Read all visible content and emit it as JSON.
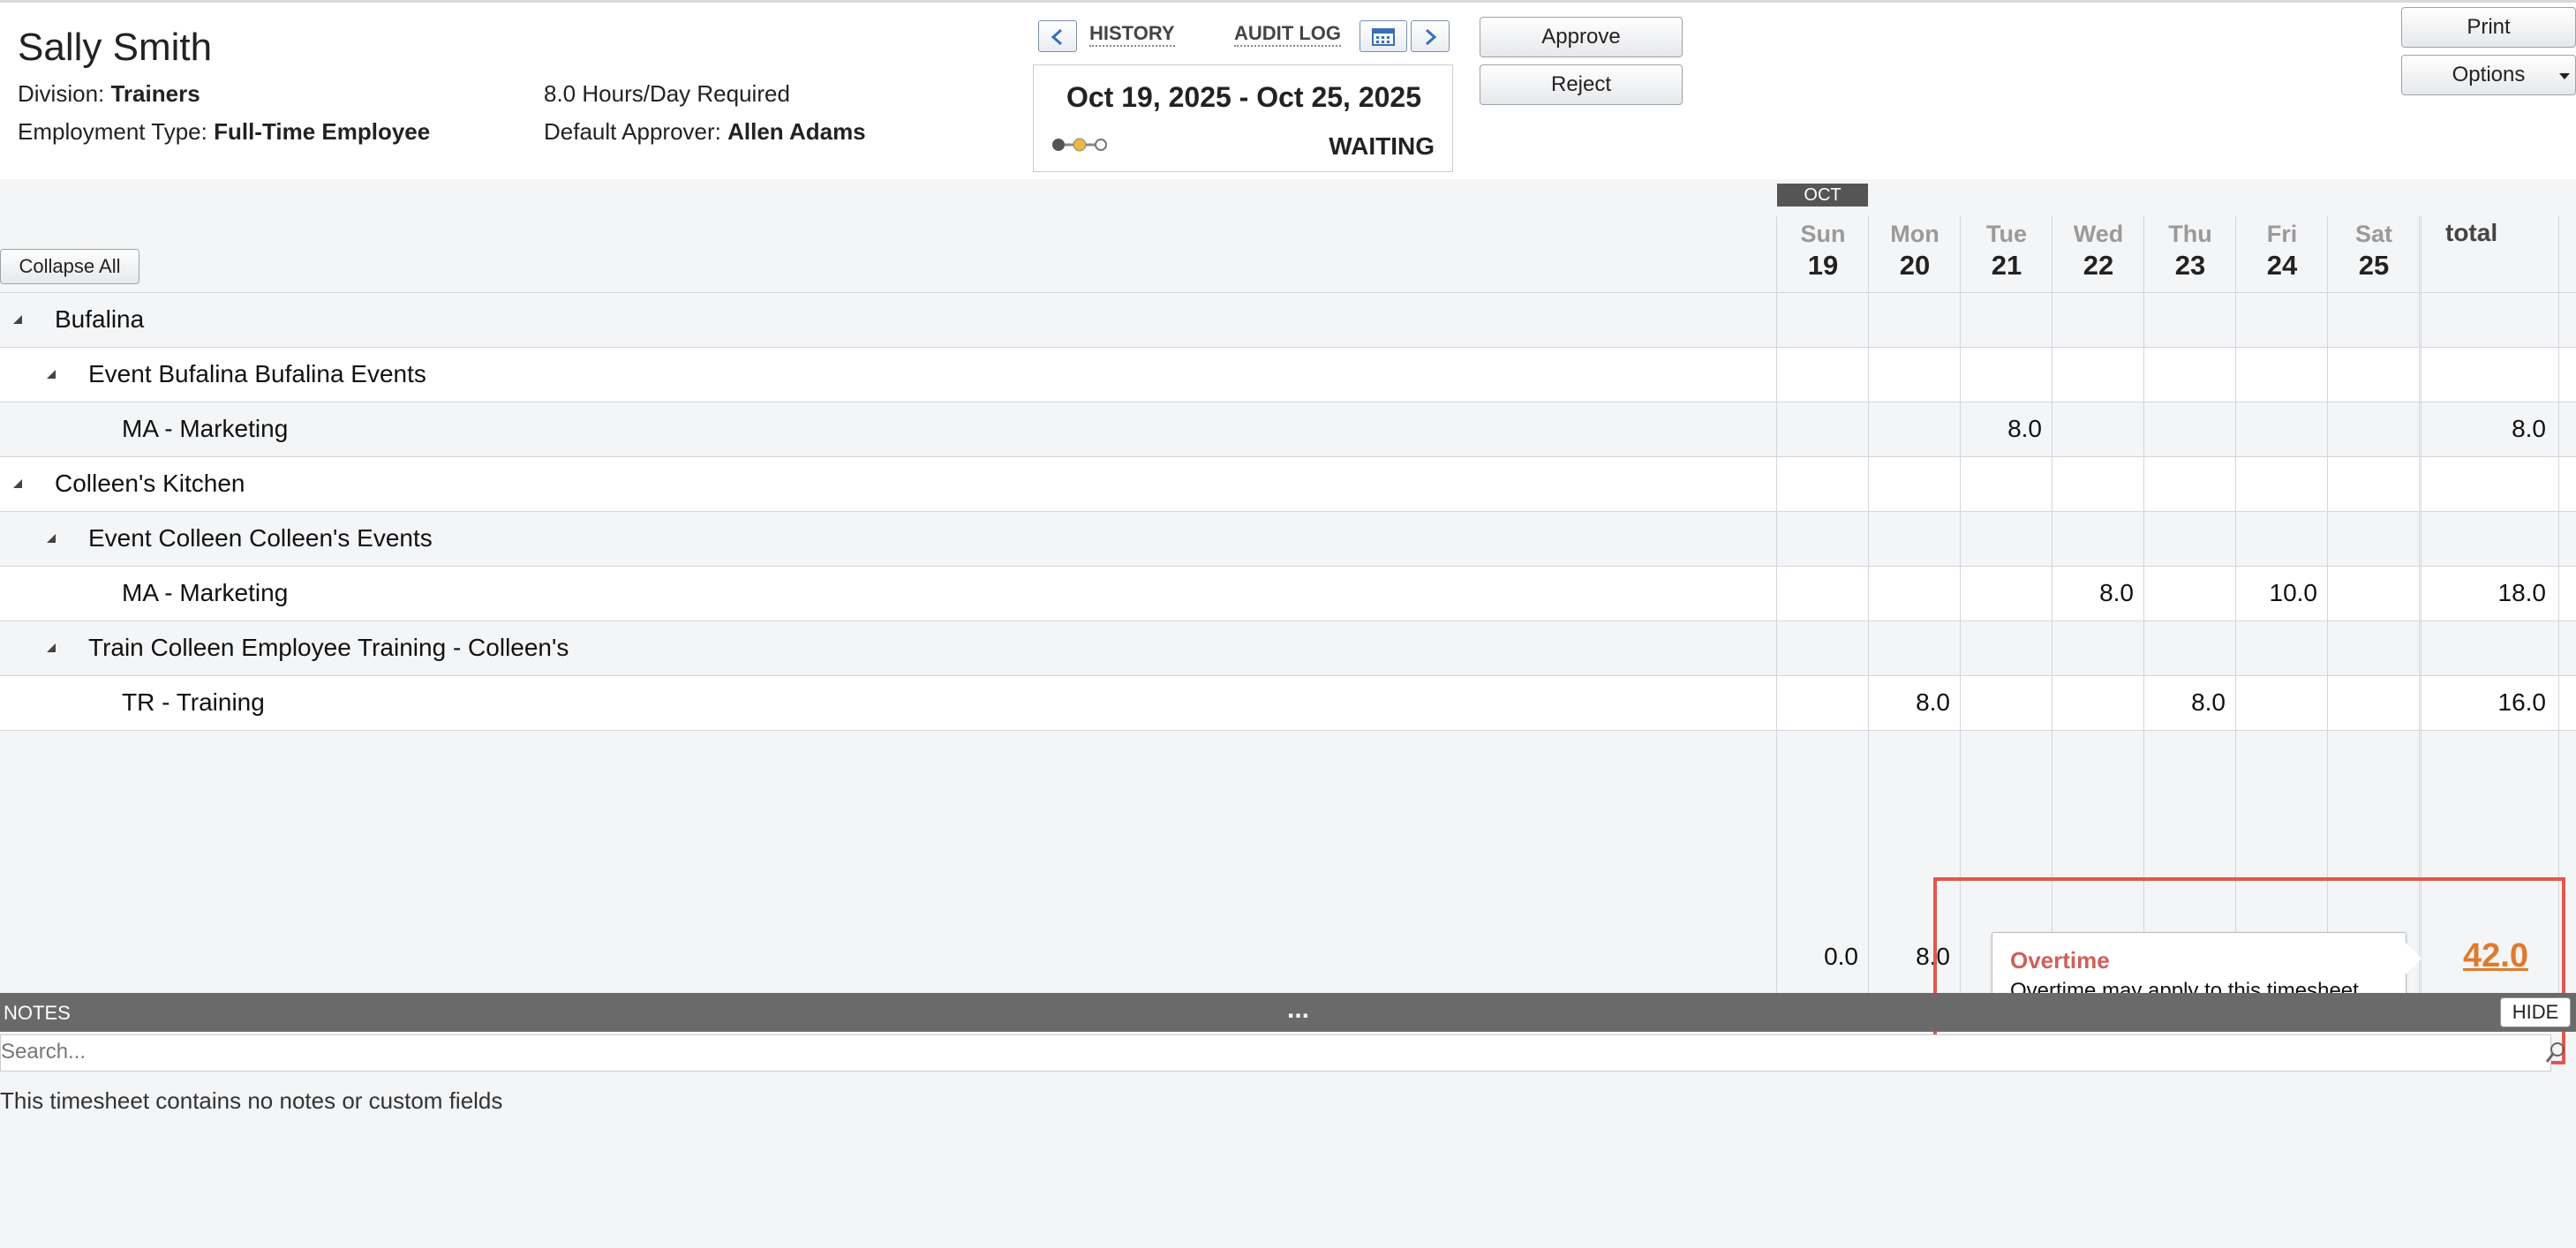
{
  "employee": {
    "name": "Sally Smith",
    "division_label": "Division:",
    "division": "Trainers",
    "employment_type_label": "Employment Type:",
    "employment_type": "Full-Time Employee",
    "hours_required": "8.0 Hours/Day Required",
    "approver_label": "Default Approver:",
    "approver": "Allen Adams"
  },
  "nav": {
    "history": "HISTORY",
    "audit_log": "AUDIT LOG"
  },
  "period": {
    "dates": "Oct 19, 2025 - Oct 25, 2025",
    "status": "WAITING",
    "progress_step": 2,
    "progress_steps": 3,
    "step_colors": [
      "#555555",
      "#e8b840",
      "#ffffff"
    ]
  },
  "actions": {
    "approve": "Approve",
    "reject": "Reject",
    "print": "Print",
    "options": "Options"
  },
  "grid": {
    "collapse_all": "Collapse All",
    "month": "OCT",
    "days": [
      {
        "name": "Sun",
        "num": "19"
      },
      {
        "name": "Mon",
        "num": "20"
      },
      {
        "name": "Tue",
        "num": "21"
      },
      {
        "name": "Wed",
        "num": "22"
      },
      {
        "name": "Thu",
        "num": "23"
      },
      {
        "name": "Fri",
        "num": "24"
      },
      {
        "name": "Sat",
        "num": "25"
      }
    ],
    "total_label": "total",
    "rows": [
      {
        "level": 0,
        "label": "Bufalina",
        "values": [
          "",
          "",
          "",
          "",
          "",
          "",
          ""
        ],
        "total": ""
      },
      {
        "level": 1,
        "label": "Event Bufalina Bufalina Events",
        "values": [
          "",
          "",
          "",
          "",
          "",
          "",
          ""
        ],
        "total": ""
      },
      {
        "level": 2,
        "label": "MA - Marketing",
        "values": [
          "",
          "",
          "8.0",
          "",
          "",
          "",
          ""
        ],
        "total": "8.0"
      },
      {
        "level": 0,
        "label": "Colleen's Kitchen",
        "values": [
          "",
          "",
          "",
          "",
          "",
          "",
          ""
        ],
        "total": ""
      },
      {
        "level": 1,
        "label": "Event Colleen Colleen's Events",
        "values": [
          "",
          "",
          "",
          "",
          "",
          "",
          ""
        ],
        "total": ""
      },
      {
        "level": 2,
        "label": "MA - Marketing",
        "values": [
          "",
          "",
          "",
          "8.0",
          "",
          "10.0",
          ""
        ],
        "total": "18.0"
      },
      {
        "level": 1,
        "label": "Train Colleen Employee Training - Colleen's",
        "values": [
          "",
          "",
          "",
          "",
          "",
          "",
          ""
        ],
        "total": ""
      },
      {
        "level": 2,
        "label": "TR - Training",
        "values": [
          "",
          "8.0",
          "",
          "",
          "8.0",
          "",
          ""
        ],
        "total": "16.0"
      }
    ],
    "day_totals": [
      "0.0",
      "8.0"
    ],
    "grand_total": "42.0"
  },
  "tooltip": {
    "title": "Overtime",
    "body": "Overtime may apply to this timesheet."
  },
  "notes": {
    "label": "NOTES",
    "ellipsis": "...",
    "hide": "HIDE",
    "search_placeholder": "Search...",
    "empty_message": "This timesheet contains no notes or custom fields"
  },
  "colors": {
    "overtime_accent": "#e07a2e",
    "tooltip_title": "#d0605a",
    "highlight_border": "#e2574c",
    "notes_bar": "#6a6a6a"
  }
}
